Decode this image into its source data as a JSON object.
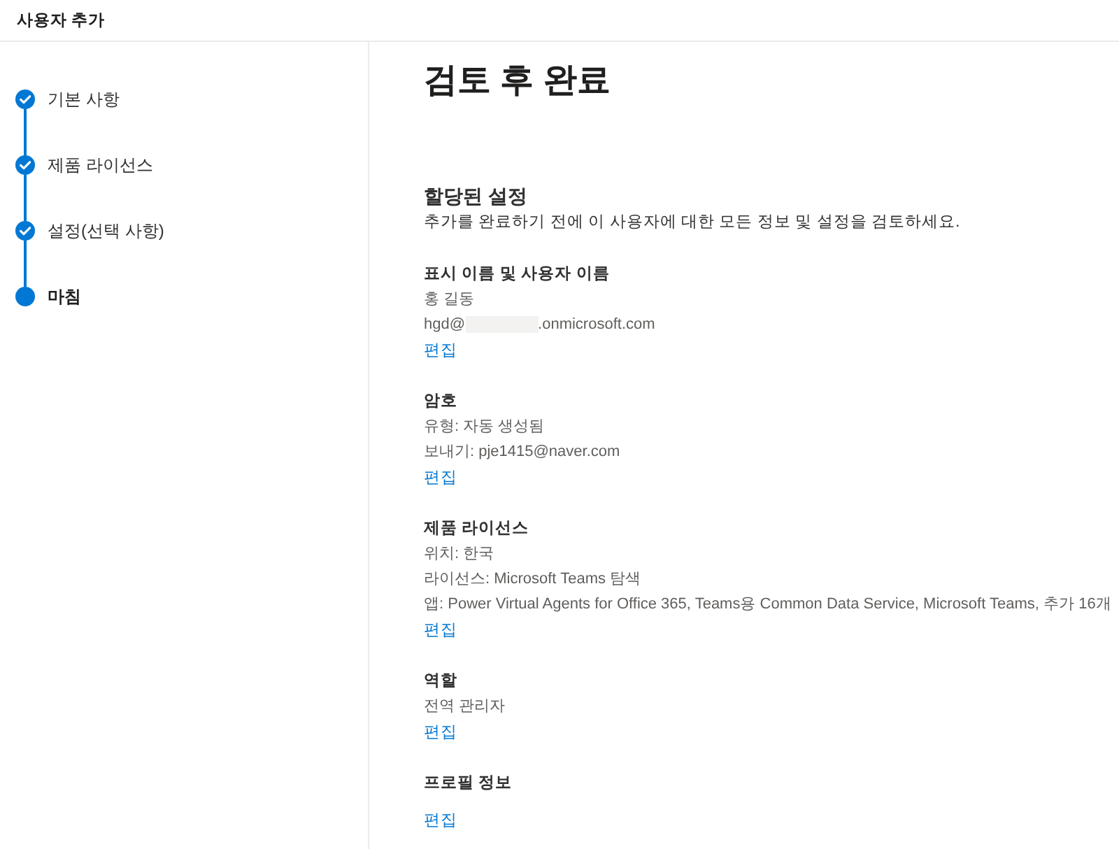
{
  "header": {
    "title": "사용자 추가"
  },
  "steps": [
    {
      "label": "기본 사항",
      "completed": true,
      "selected": false
    },
    {
      "label": "제품 라이선스",
      "completed": true,
      "selected": false
    },
    {
      "label": "설정(선택 사항)",
      "completed": true,
      "selected": false
    },
    {
      "label": "마침",
      "completed": false,
      "selected": true
    }
  ],
  "page_title": "검토 후 완료",
  "summary": {
    "heading": "할당된 설정",
    "description": "추가를 완료하기 전에 이 사용자에 대한 모든 정보 및 설정을 검토하세요."
  },
  "sections": [
    {
      "heading": "표시 이름 및 사용자 이름",
      "lines": [
        {
          "kind": "text",
          "text": "홍 길동"
        },
        {
          "kind": "redacted",
          "before": "hgd@",
          "after": ".onmicrosoft.com"
        }
      ],
      "edit_link": "편집"
    },
    {
      "heading": "암호",
      "lines": [
        {
          "kind": "text",
          "text": "유형: 자동 생성됨"
        },
        {
          "kind": "text",
          "text": "보내기: pje1415@naver.com"
        }
      ],
      "edit_link": "편집"
    },
    {
      "heading": "제품 라이선스",
      "lines": [
        {
          "kind": "text",
          "text": "위치: 한국"
        },
        {
          "kind": "text",
          "text": "라이선스: Microsoft Teams 탐색"
        },
        {
          "kind": "text",
          "text": "앱: Power Virtual Agents for Office 365, Teams용 Common Data Service, Microsoft Teams, 추가 16개"
        }
      ],
      "edit_link": "편집"
    },
    {
      "heading": "역할",
      "lines": [
        {
          "kind": "text",
          "text": "전역 관리자"
        }
      ],
      "edit_link": "편집"
    },
    {
      "heading": "프로필 정보",
      "edit_link": "편집"
    }
  ]
}
